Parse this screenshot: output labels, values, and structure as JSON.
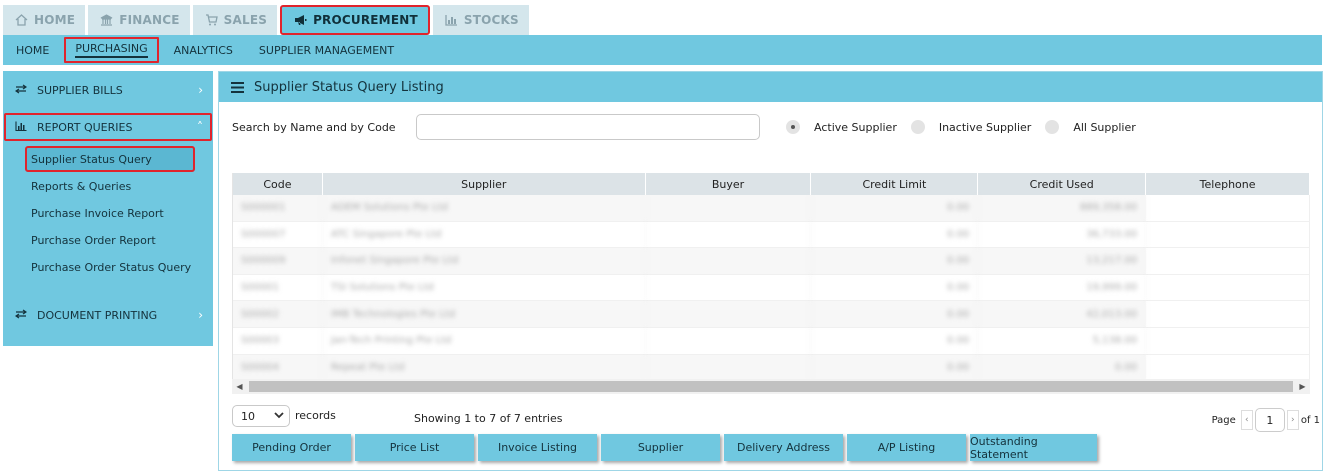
{
  "top_tabs": [
    {
      "label": "HOME",
      "icon": "home-icon"
    },
    {
      "label": "FINANCE",
      "icon": "bank-icon"
    },
    {
      "label": "SALES",
      "icon": "cart-icon"
    },
    {
      "label": "PROCUREMENT",
      "icon": "megaphone-icon",
      "active": true
    },
    {
      "label": "STOCKS",
      "icon": "bar-chart-icon"
    }
  ],
  "sub_nav": [
    {
      "label": "HOME"
    },
    {
      "label": "PURCHASING",
      "active": true
    },
    {
      "label": "ANALYTICS"
    },
    {
      "label": "SUPPLIER MANAGEMENT"
    }
  ],
  "sidebar": {
    "sections": [
      {
        "label": "SUPPLIER BILLS",
        "icon": "swap-icon"
      },
      {
        "label": "REPORT QUERIES",
        "icon": "chart-icon"
      },
      {
        "label": "DOCUMENT PRINTING",
        "icon": "swap-icon"
      }
    ],
    "report_items": [
      "Supplier Status Query",
      "Reports & Queries",
      "Purchase Invoice Report",
      "Purchase Order Report",
      "Purchase Order Status Query"
    ]
  },
  "panel": {
    "title": "Supplier Status Query Listing",
    "search_label": "Search by Name and by Code",
    "search_value": "",
    "search_placeholder": "",
    "radios": [
      {
        "label": "Active Supplier",
        "checked": true
      },
      {
        "label": "Inactive Supplier",
        "checked": false
      },
      {
        "label": "All Supplier",
        "checked": false
      }
    ]
  },
  "table": {
    "columns": [
      "Code",
      "Supplier",
      "Buyer",
      "Credit Limit",
      "Credit Used",
      "Telephone"
    ],
    "rows": [
      [
        "S000001",
        "ADEM Solutions Pte Ltd",
        "",
        "0.00",
        "889,358.00",
        ""
      ],
      [
        "S000007",
        "ATC Singapore Pte Ltd",
        "",
        "0.00",
        "36,733.00",
        ""
      ],
      [
        "S000009",
        "Infonet Singapore Pte Ltd",
        "",
        "0.00",
        "13,217.00",
        ""
      ],
      [
        "S00001",
        "TSI Solutions Pte Ltd",
        "",
        "0.00",
        "19,999.00",
        ""
      ],
      [
        "S00002",
        "IMB Technologies Pte Ltd",
        "",
        "0.00",
        "42,013.00",
        ""
      ],
      [
        "S00003",
        "Jan-Tech Printing Pte Ltd",
        "",
        "0.00",
        "5,138.00",
        ""
      ],
      [
        "S00004",
        "Repeat Pte Ltd",
        "",
        "0.00",
        "0.00",
        ""
      ]
    ]
  },
  "footer": {
    "page_length": "10",
    "records_label": "records",
    "info": "Showing 1 to 7 of 7 entries",
    "page_label": "Page",
    "page_value": "1",
    "of_label": "of 1"
  },
  "actions": [
    "Pending Order",
    "Price List",
    "Invoice Listing",
    "Supplier",
    "Delivery Address",
    "A/P Listing",
    "Outstanding Statement"
  ]
}
